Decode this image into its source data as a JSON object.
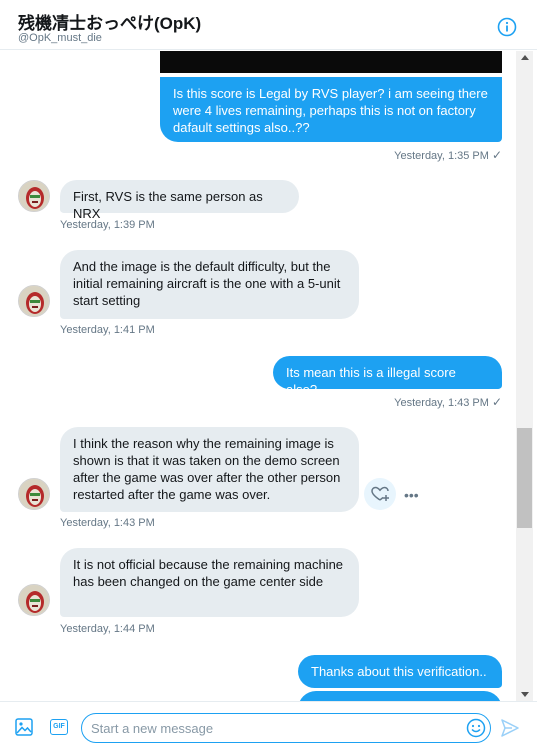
{
  "header": {
    "title": "残機凊士おっぺけ(OpK)",
    "handle": "@OpK_must_die",
    "info_icon": "info-icon"
  },
  "messages": [
    {
      "id": "m1",
      "direction": "outgoing",
      "text": "Is this score is Legal by RVS player? i am seeing there were 4 lives remaining, perhaps this is not on factory dafault settings also..??",
      "time": "Yesterday, 1:35 PM",
      "read": true
    },
    {
      "id": "m2",
      "direction": "incoming",
      "text": "First, RVS is the same person as NRX",
      "time": "Yesterday, 1:39 PM"
    },
    {
      "id": "m3",
      "direction": "incoming",
      "text": "And the image is the default difficulty, but the initial remaining aircraft is the one with a 5-unit start setting",
      "time": "Yesterday, 1:41 PM"
    },
    {
      "id": "m4",
      "direction": "outgoing",
      "text": "Its mean this is a illegal score also?",
      "time": "Yesterday, 1:43 PM",
      "read": true
    },
    {
      "id": "m5",
      "direction": "incoming",
      "text": "I think the reason why the remaining image is shown is that it was taken on the demo screen after the game was over after the other person restarted after the game was over.",
      "time": "Yesterday, 1:43 PM"
    },
    {
      "id": "m6",
      "direction": "incoming",
      "text": "It is not official because the remaining machine has been changed on the game center side",
      "time": "Yesterday, 1:44 PM"
    },
    {
      "id": "m7",
      "direction": "outgoing",
      "text": "Thanks about this verification..",
      "time": ""
    }
  ],
  "composer": {
    "placeholder": "Start a new message",
    "gif_label": "GIF"
  },
  "read_mark": "✓",
  "more_label": "•••",
  "colors": {
    "accent": "#1da1f2",
    "incoming_bubble": "#e6ecf0",
    "meta_text": "#657786"
  }
}
